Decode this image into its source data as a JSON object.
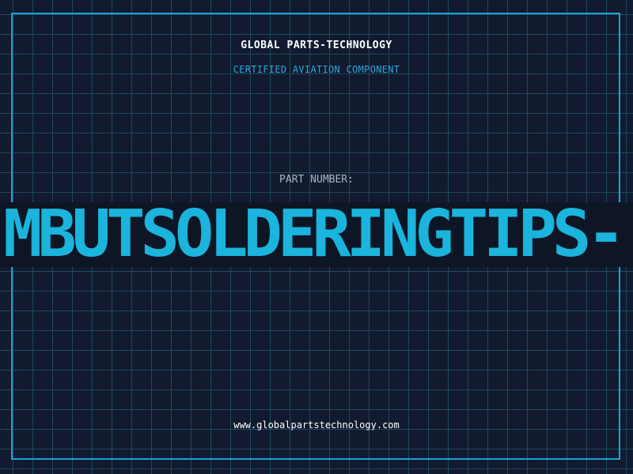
{
  "header": {
    "company": "GLOBAL PARTS-TECHNOLOGY",
    "subtitle": "CERTIFIED AVIATION COMPONENT"
  },
  "part": {
    "label": "PART NUMBER:",
    "number": "MBUTSOLDERINGTIPS-"
  },
  "footer": {
    "website": "www.globalpartstechnology.com"
  },
  "colors": {
    "background": "#111a2e",
    "grid": "#1f4a5f",
    "accent": "#1ab4dc",
    "border": "#1aa3d8"
  }
}
